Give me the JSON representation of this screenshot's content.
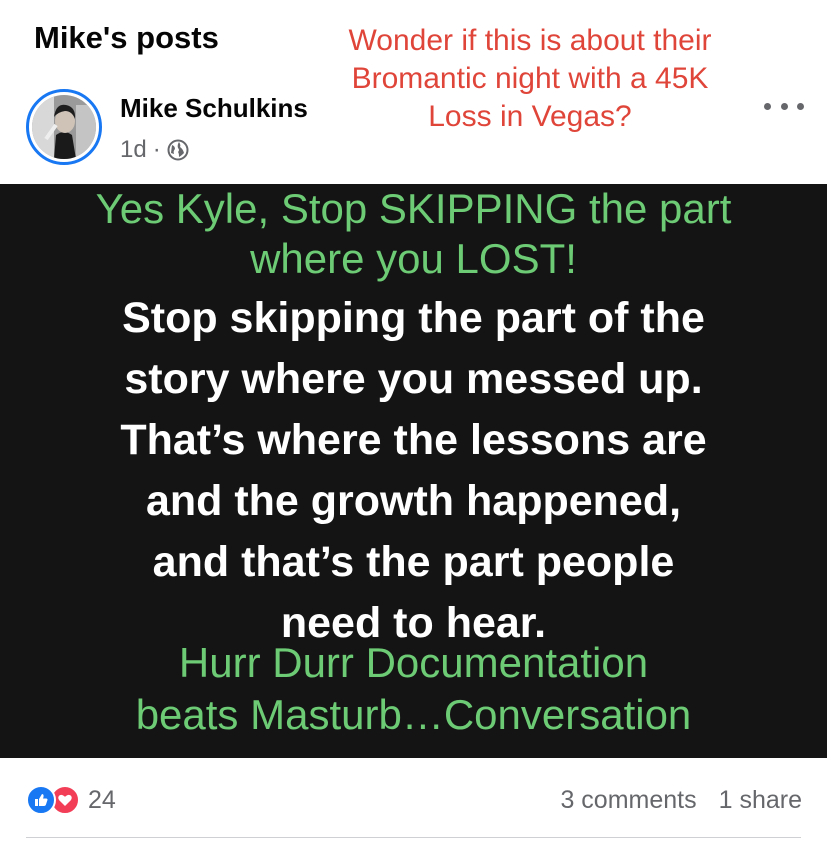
{
  "header": {
    "section_title": "Mike's posts"
  },
  "annotation": {
    "lines": [
      "Wonder if this is about their",
      "Bromantic night with a 45K",
      "Loss in Vegas?"
    ]
  },
  "post": {
    "author": "Mike Schulkins",
    "age": "1d",
    "separator": "·",
    "audience_icon": "globe-icon",
    "more_icon": "more-options-icon",
    "image_text": {
      "green_top": [
        "Yes Kyle, Stop SKIPPING the part",
        "where you LOST!"
      ],
      "white": [
        "Stop skipping the part of the",
        "story where you messed up.",
        "That’s where the lessons are",
        "and the growth happened,",
        "and that’s the part people",
        "need to hear."
      ],
      "green_bottom": [
        "Hurr Durr Documentation",
        "beats Masturb…Conversation"
      ]
    }
  },
  "footer": {
    "reaction_icons": [
      "like-icon",
      "love-icon"
    ],
    "reaction_count": "24",
    "comments": "3 comments",
    "shares": "1 share"
  },
  "colors": {
    "annotation_red": "#e0453a",
    "overlay_green": "#6ccb74",
    "facebook_blue": "#1877f2",
    "love_red": "#f33e58",
    "image_background": "#141414"
  }
}
